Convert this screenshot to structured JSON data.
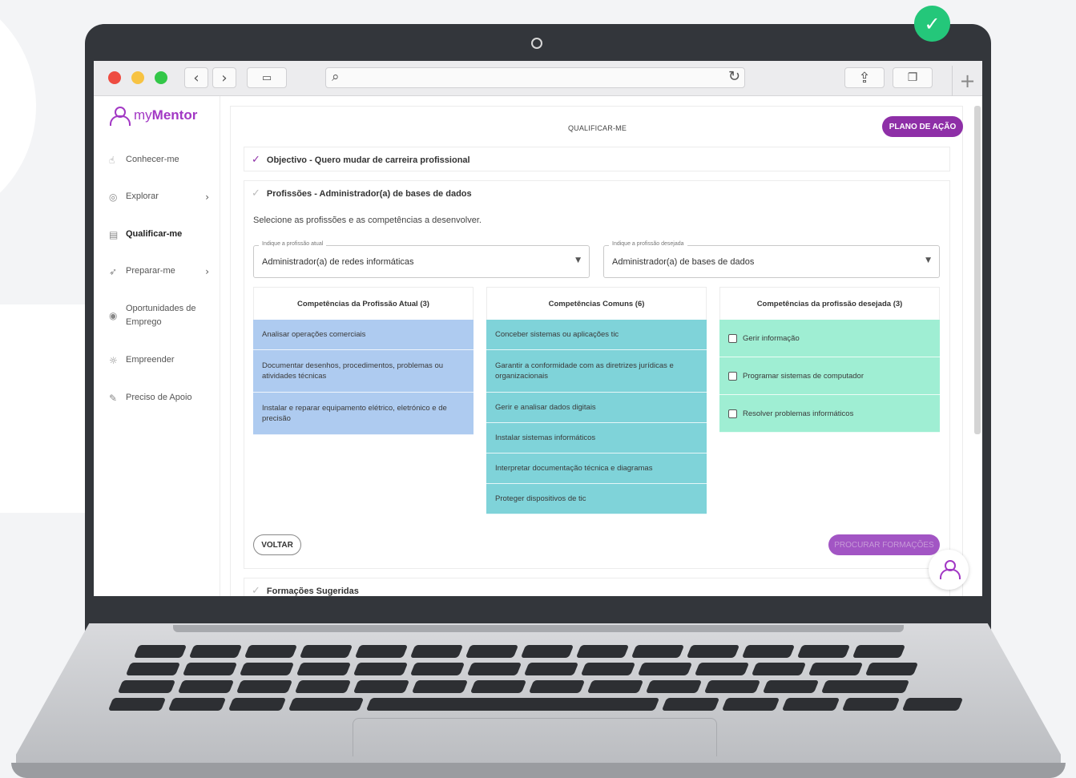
{
  "app": {
    "brand_prefix": "my",
    "brand_name": "Mentor"
  },
  "sidebar": {
    "items": [
      {
        "label": "Conhecer-me",
        "icon": "hand-icon",
        "has_chevron": false,
        "active": false
      },
      {
        "label": "Explorar",
        "icon": "compass-icon",
        "has_chevron": true,
        "active": false
      },
      {
        "label": "Qualificar-me",
        "icon": "certificate-icon",
        "has_chevron": false,
        "active": true
      },
      {
        "label": "Preparar-me",
        "icon": "rocket-icon",
        "has_chevron": true,
        "active": false
      },
      {
        "label": "Oportunidades de Emprego",
        "icon": "search-job-icon",
        "has_chevron": false,
        "active": false
      },
      {
        "label": "Empreender",
        "icon": "lightbulb-icon",
        "has_chevron": false,
        "active": false
      },
      {
        "label": "Preciso de Apoio",
        "icon": "support-icon",
        "has_chevron": false,
        "active": false
      }
    ]
  },
  "header": {
    "title": "QUALIFICAR-ME",
    "plano_button": "PLANO DE AÇÃO"
  },
  "sections": {
    "objectivo": "Objectivo - Quero mudar de carreira profissional",
    "profissoes": "Profissões - Administrador(a) de bases de dados",
    "formacoes": "Formações Sugeridas"
  },
  "instruction": "Selecione as profissões e as competências a desenvolver.",
  "selects": {
    "atual_label": "Indique a profissão atual",
    "atual_value": "Administrador(a) de redes informáticas",
    "desejada_label": "Indique a profissão desejada",
    "desejada_value": "Administrador(a) de bases de dados"
  },
  "columns": {
    "atual": {
      "title": "Competências da Profissão Atual  (3)",
      "items": [
        "Analisar operações comerciais",
        "Documentar desenhos, procedimentos, problemas ou atividades técnicas",
        "Instalar e reparar equipamento elétrico, eletrónico e de precisão"
      ]
    },
    "comuns": {
      "title": "Competências Comuns  (6)",
      "items": [
        "Conceber sistemas ou aplicações tic",
        "Garantir a conformidade com as diretrizes jurídicas e organizacionais",
        "Gerir e analisar dados digitais",
        "Instalar sistemas informáticos",
        "Interpretar documentação técnica e diagramas",
        "Proteger dispositivos de tic"
      ]
    },
    "desejada": {
      "title": "Competências da profissão desejada  (3)",
      "items": [
        "Gerir informação",
        "Programar sistemas de computador",
        "Resolver problemas informáticos"
      ]
    }
  },
  "buttons": {
    "voltar": "VOLTAR",
    "procurar": "PROCURAR FORMAÇÕES"
  },
  "colors": {
    "accent": "#8e2fa7",
    "atual": "#aecbf0",
    "comuns": "#7fd3d9",
    "desejada": "#9feed3",
    "success": "#24c77a"
  }
}
